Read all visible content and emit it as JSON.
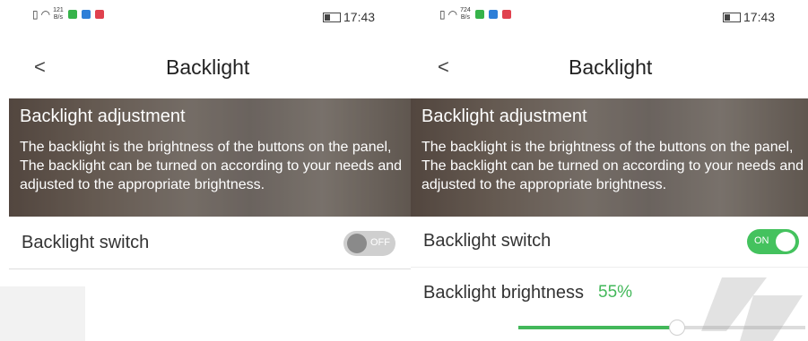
{
  "screens": [
    {
      "status": {
        "speed_value": "121",
        "speed_unit": "B/s",
        "time": "17:43"
      },
      "title": "Backlight",
      "banner": {
        "heading": "Backlight adjustment",
        "body": "The backlight is the brightness of the buttons on the panel,",
        "body2": "The backlight can be turned on according to your needs and adjusted to the appropriate brightness."
      },
      "switch": {
        "label": "Backlight switch",
        "state_text": "OFF"
      }
    },
    {
      "status": {
        "speed_value": "724",
        "speed_unit": "B/s",
        "time": "17:43"
      },
      "title": "Backlight",
      "banner": {
        "heading": "Backlight adjustment",
        "body": "The backlight is the brightness of the buttons on the panel,",
        "body2": "The backlight can be turned on according to your needs and adjusted to the appropriate brightness."
      },
      "switch": {
        "label": "Backlight switch",
        "state_text": "ON"
      },
      "brightness": {
        "label": "Backlight brightness",
        "value_text": "55%",
        "value_fraction": 0.55
      }
    }
  ],
  "colors": {
    "accent_green": "#43b85a",
    "toggle_on": "#44c25e",
    "toggle_off": "#cfcfcf"
  }
}
